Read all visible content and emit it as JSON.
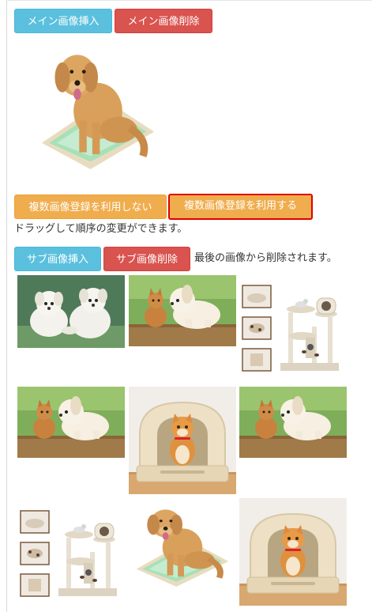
{
  "main_image": {
    "insert_label": "メイン画像挿入",
    "delete_label": "メイン画像削除",
    "image_icon": "dog-on-pet-tray-image"
  },
  "multi_image": {
    "disable_label": "複数画像登録を利用しない",
    "enable_label": "複数画像登録を利用する",
    "active_option": "enable",
    "drag_hint": "ドラッグして順序の変更ができます。"
  },
  "sub_images": {
    "insert_label": "サブ画像挿入",
    "delete_label": "サブ画像削除",
    "delete_note": "最後の画像から削除されます。",
    "items": [
      {
        "icon": "two-white-puppies-image"
      },
      {
        "icon": "puppy-and-kitten-image"
      },
      {
        "icon": "cat-tower-image"
      },
      {
        "icon": "puppy-and-kitten-image"
      },
      {
        "icon": "cat-litter-box-image"
      },
      {
        "icon": "puppy-and-kitten-image"
      },
      {
        "icon": "cat-tower-image"
      },
      {
        "icon": "dog-on-pet-tray-image"
      },
      {
        "icon": "cat-litter-box-image"
      }
    ]
  },
  "colors": {
    "info": "#5bc0de",
    "danger": "#d9534f",
    "warning": "#f0ad4e",
    "active_border": "#e00000"
  }
}
